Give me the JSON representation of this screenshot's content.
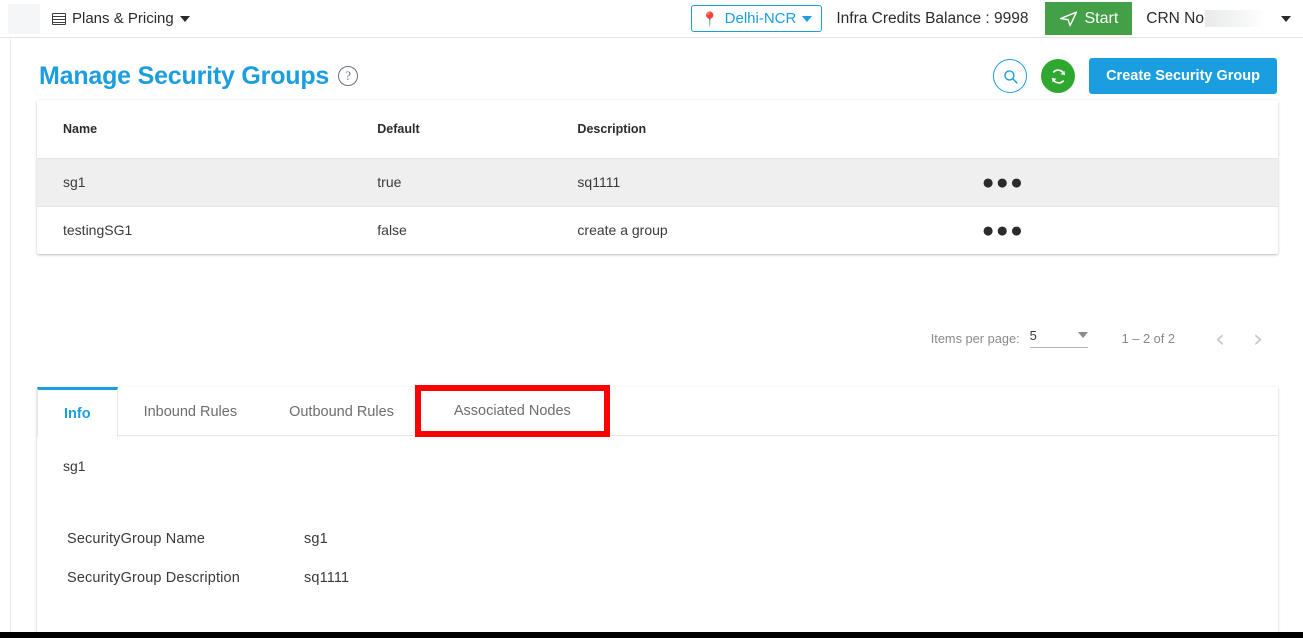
{
  "topbar": {
    "logo": "logo-placeholder",
    "plans_menu_label": "Plans & Pricing",
    "grid_icon": "grid-icon",
    "caret_icon": "chevron-down-icon",
    "region": {
      "label": "Delhi-NCR",
      "pin_icon": "location-pin-icon",
      "caret_icon": "chevron-down-icon",
      "accent": "#1a9ee0"
    },
    "credits_label": "Infra Credits Balance : 9998",
    "start_button": {
      "label": "Start",
      "icon": "send-plane-icon",
      "color": "#43a047"
    },
    "crn_label": "CRN No",
    "crn_caret_icon": "chevron-down-icon"
  },
  "header": {
    "title": "Manage Security Groups",
    "help_icon": "question-circle-icon",
    "search_icon": "search-icon",
    "refresh_icon": "refresh-icon",
    "create_button_label": "Create Security Group",
    "accent": "#1a9ee0",
    "refresh_color": "#2fa82f"
  },
  "table": {
    "columns": [
      "Name",
      "Default",
      "Description",
      ""
    ],
    "rows": [
      {
        "name": "sg1",
        "default": "true",
        "description": "sq1111",
        "menu_icon": "more-horizontal-icon",
        "selected": true
      },
      {
        "name": "testingSG1",
        "default": "false",
        "description": "create a group",
        "menu_icon": "more-horizontal-icon",
        "selected": false
      }
    ]
  },
  "paginator": {
    "items_per_page_label": "Items per page:",
    "items_per_page_value": "5",
    "caret_icon": "chevron-down-icon",
    "range_label": "1 – 2 of 2",
    "prev_icon": "chevron-left-icon",
    "next_icon": "chevron-right-icon"
  },
  "tabs": {
    "items": [
      {
        "label": "Info",
        "active": true,
        "highlighted": false
      },
      {
        "label": "Inbound Rules",
        "active": false,
        "highlighted": false
      },
      {
        "label": "Outbound Rules",
        "active": false,
        "highlighted": false
      },
      {
        "label": "Associated Nodes",
        "active": false,
        "highlighted": true
      }
    ],
    "highlight_color": "#f90202"
  },
  "info_panel": {
    "heading": "sg1",
    "fields": [
      {
        "key": "SecurityGroup Name",
        "value": "sg1"
      },
      {
        "key": "SecurityGroup Description",
        "value": "sq1111"
      }
    ]
  }
}
